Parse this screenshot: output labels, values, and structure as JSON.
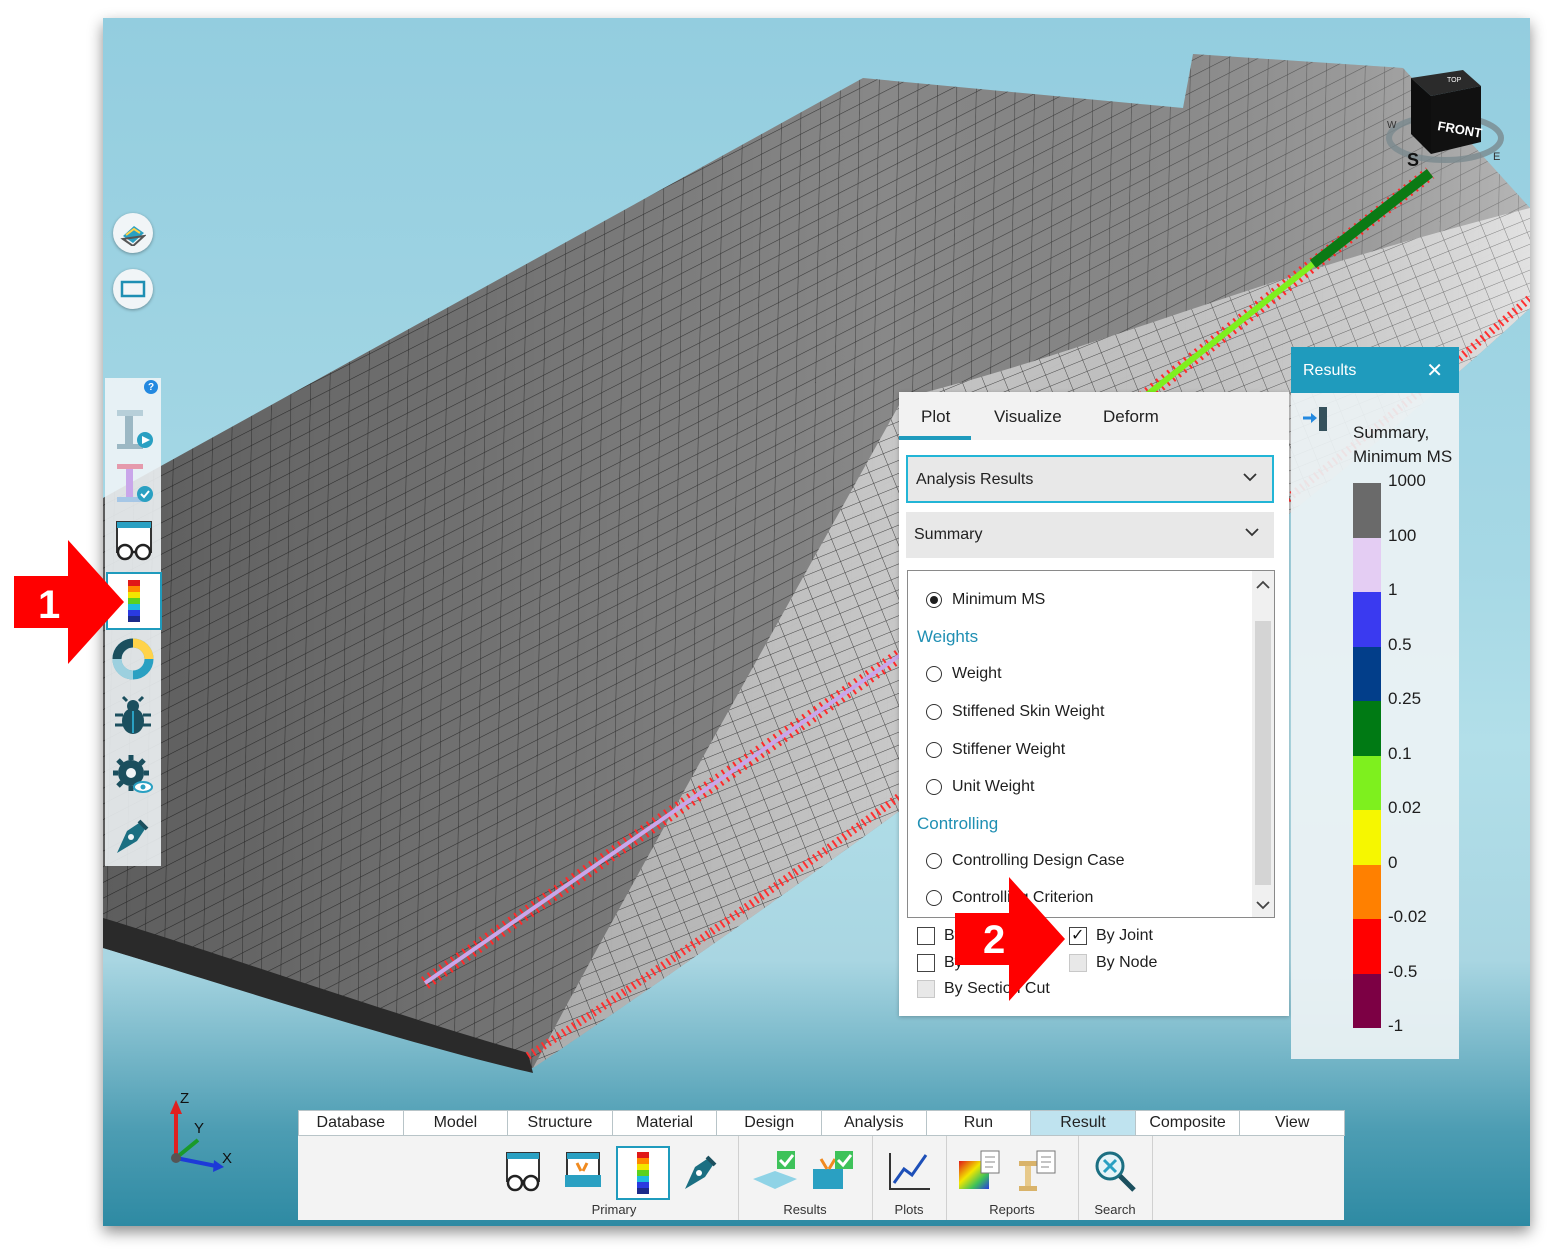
{
  "plot_panel": {
    "tabs": [
      "Plot",
      "Visualize",
      "Deform"
    ],
    "dropdown_primary": "Analysis Results",
    "dropdown_secondary": "Summary",
    "selected_option": "Minimum MS",
    "group_weights": "Weights",
    "weights_options": [
      "Weight",
      "Stiffened Skin Weight",
      "Stiffener Weight",
      "Unit Weight"
    ],
    "group_controlling": "Controlling",
    "controlling_options": [
      "Controlling Design Case",
      "Controlling Criterion"
    ],
    "checkboxes": {
      "by_1": "By",
      "by_2": "By",
      "by_section_cut": "By Section Cut",
      "by_joint": "By Joint",
      "by_node": "By Node"
    }
  },
  "results_panel": {
    "title": "Results",
    "close_icon": "✕",
    "legend_title_1": "Summary,",
    "legend_title_2": "Minimum MS",
    "legend": [
      {
        "label": "1000",
        "color": "#6a6a6a"
      },
      {
        "label": "100",
        "color": "#e4cdf3"
      },
      {
        "label": "1",
        "color": "#3a3af0"
      },
      {
        "label": "0.5",
        "color": "#023e8a"
      },
      {
        "label": "0.25",
        "color": "#007a14"
      },
      {
        "label": "0.1",
        "color": "#7ef01e"
      },
      {
        "label": "0.02",
        "color": "#f6f700"
      },
      {
        "label": "0",
        "color": "#ff8000"
      },
      {
        "label": "-0.02",
        "color": "#ff0000"
      },
      {
        "label": "-0.5",
        "color": "#7c0044"
      },
      {
        "label": "-1",
        "color": ""
      }
    ]
  },
  "ribbon": {
    "tabs": [
      "Database",
      "Model",
      "Structure",
      "Material",
      "Design",
      "Analysis",
      "Run",
      "Result",
      "Composite",
      "View"
    ],
    "active_tab": "Result",
    "groups": [
      "Primary",
      "Results",
      "Plots",
      "Reports",
      "Search"
    ]
  },
  "view_cube": {
    "front": "FRONT",
    "top": "TOP",
    "south": "S",
    "west": "W",
    "east": "E"
  },
  "axes": {
    "z": "Z",
    "y": "Y",
    "x": "X"
  },
  "callouts": {
    "one": "1",
    "two": "2"
  },
  "colors": {
    "accent": "#1f9bbd",
    "callout": "#ff0000",
    "mesh": "#8c8c8c"
  },
  "left_toolbar_icons": [
    "beam-play-icon",
    "beam-check-icon",
    "glasses-window-icon",
    "color-bar-icon",
    "donut-chart-icon",
    "bug-icon",
    "gear-eye-icon",
    "pen-nib-icon"
  ]
}
